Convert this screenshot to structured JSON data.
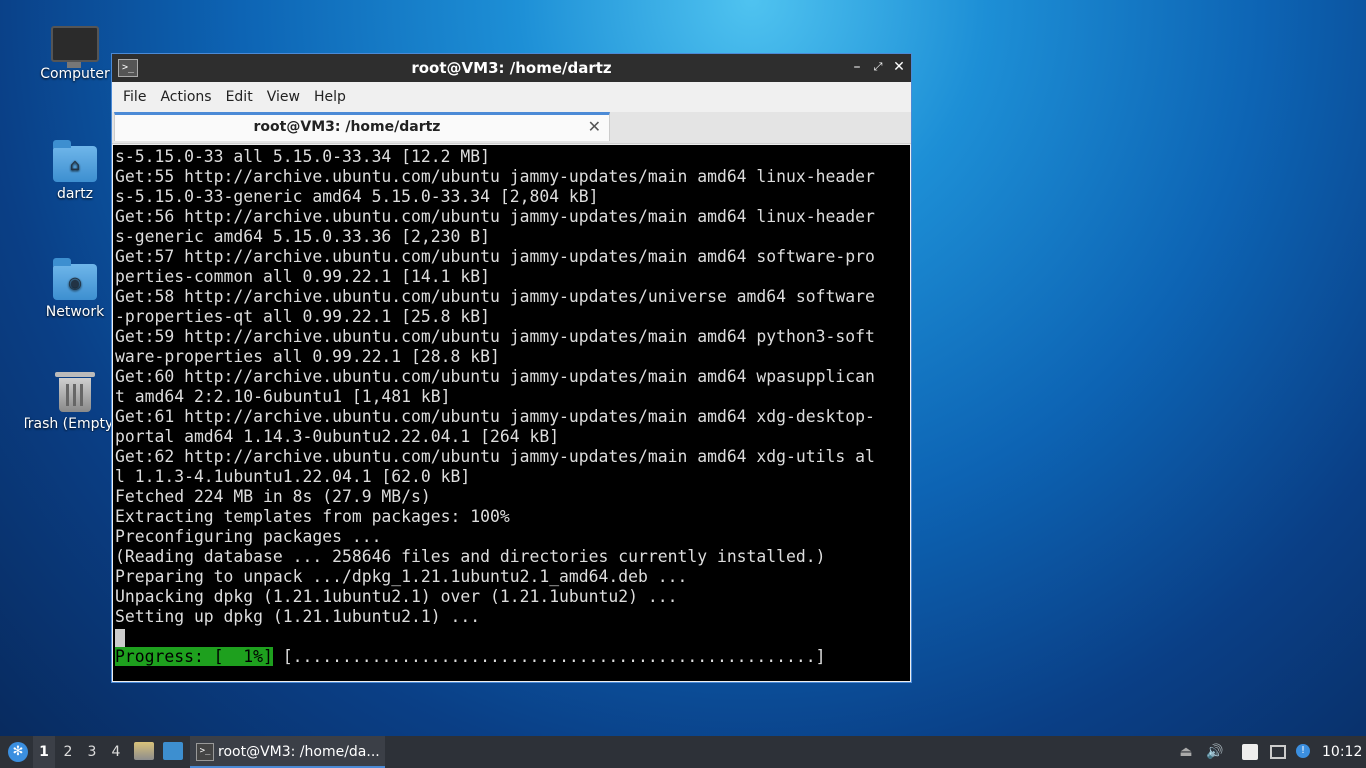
{
  "desktop": {
    "icons": [
      {
        "label": "Computer"
      },
      {
        "label": "dartz"
      },
      {
        "label": "Network"
      },
      {
        "label": "Trash (Empty)"
      }
    ]
  },
  "window": {
    "title": "root@VM3: /home/dartz",
    "menu": [
      "File",
      "Actions",
      "Edit",
      "View",
      "Help"
    ],
    "tab_title": "root@VM3: /home/dartz",
    "terminal_lines": [
      "s-5.15.0-33 all 5.15.0-33.34 [12.2 MB]",
      "Get:55 http://archive.ubuntu.com/ubuntu jammy-updates/main amd64 linux-header",
      "s-5.15.0-33-generic amd64 5.15.0-33.34 [2,804 kB]",
      "Get:56 http://archive.ubuntu.com/ubuntu jammy-updates/main amd64 linux-header",
      "s-generic amd64 5.15.0.33.36 [2,230 B]",
      "Get:57 http://archive.ubuntu.com/ubuntu jammy-updates/main amd64 software-pro",
      "perties-common all 0.99.22.1 [14.1 kB]",
      "Get:58 http://archive.ubuntu.com/ubuntu jammy-updates/universe amd64 software",
      "-properties-qt all 0.99.22.1 [25.8 kB]",
      "Get:59 http://archive.ubuntu.com/ubuntu jammy-updates/main amd64 python3-soft",
      "ware-properties all 0.99.22.1 [28.8 kB]",
      "Get:60 http://archive.ubuntu.com/ubuntu jammy-updates/main amd64 wpasupplican",
      "t amd64 2:2.10-6ubuntu1 [1,481 kB]",
      "Get:61 http://archive.ubuntu.com/ubuntu jammy-updates/main amd64 xdg-desktop-",
      "portal amd64 1.14.3-0ubuntu2.22.04.1 [264 kB]",
      "Get:62 http://archive.ubuntu.com/ubuntu jammy-updates/main amd64 xdg-utils al",
      "l 1.1.3-4.1ubuntu1.22.04.1 [62.0 kB]",
      "Fetched 224 MB in 8s (27.9 MB/s)",
      "Extracting templates from packages: 100%",
      "Preconfiguring packages ...",
      "(Reading database ... 258646 files and directories currently installed.)",
      "Preparing to unpack .../dpkg_1.21.1ubuntu2.1_amd64.deb ...",
      "Unpacking dpkg (1.21.1ubuntu2.1) over (1.21.1ubuntu2) ...",
      "Setting up dpkg (1.21.1ubuntu2.1) ..."
    ],
    "progress_label": "Progress: [  1%]",
    "progress_bar": " [.....................................................]",
    "progress_percent": 1
  },
  "taskbar": {
    "workspaces": [
      "1",
      "2",
      "3",
      "4"
    ],
    "active_task": "root@VM3: /home/da...",
    "clock": "10:12"
  },
  "colors": {
    "accent": "#4b8ad6",
    "progress_green": "#1ea01e",
    "taskbar_bg": "#2d3138"
  }
}
